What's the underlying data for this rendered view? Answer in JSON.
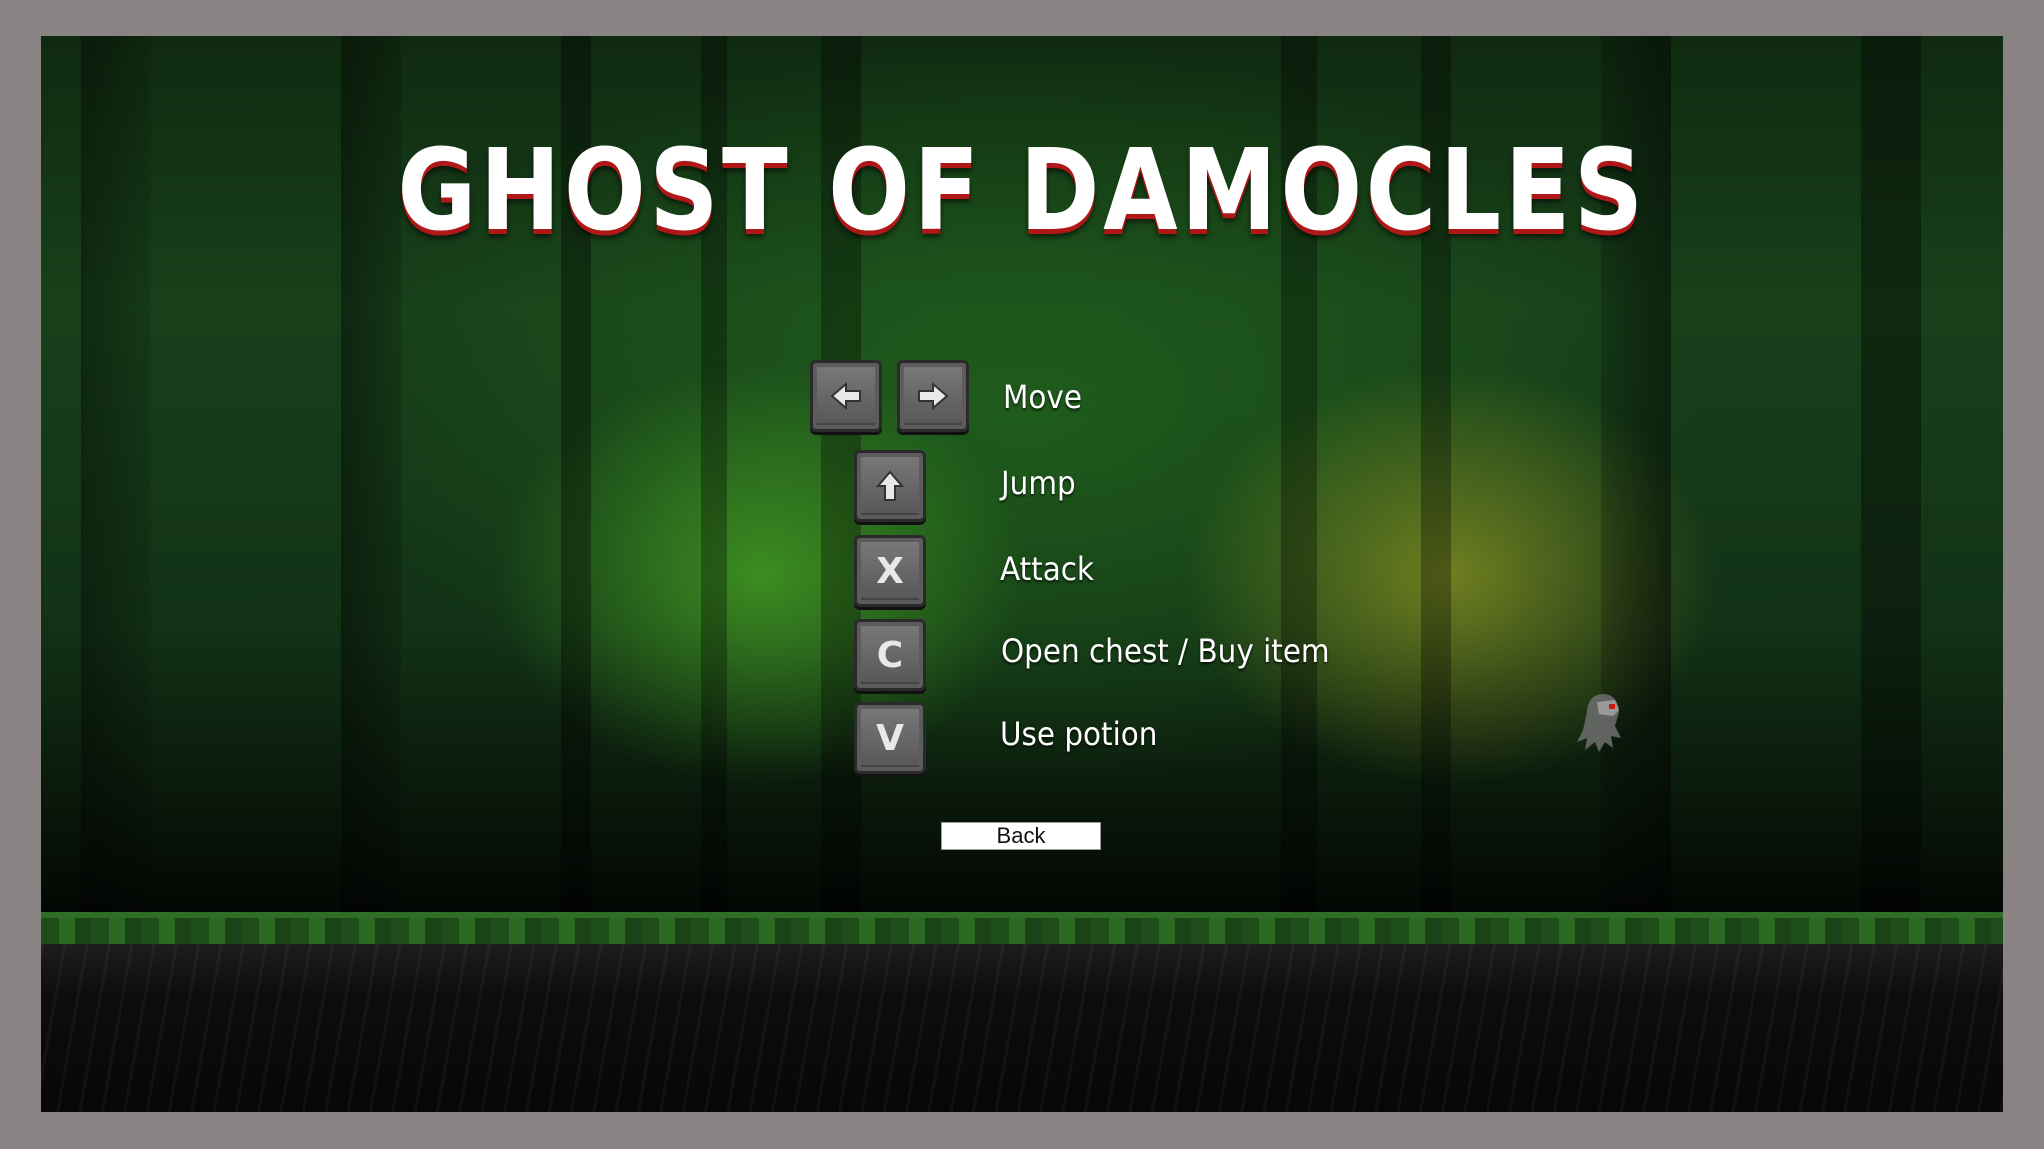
{
  "game": {
    "title": "GHOST OF DAMOCLES"
  },
  "controls": [
    {
      "keys": [
        "left-arrow-icon",
        "right-arrow-icon"
      ],
      "label": "Move"
    },
    {
      "keys": [
        "up-arrow-icon"
      ],
      "label": "Jump"
    },
    {
      "keys": [
        "X"
      ],
      "label": "Attack"
    },
    {
      "keys": [
        "C"
      ],
      "label": "Open chest / Buy item"
    },
    {
      "keys": [
        "V"
      ],
      "label": "Use potion"
    }
  ],
  "menu": {
    "back_label": "Back"
  },
  "colors": {
    "frame": "#8a8384",
    "title_text": "#ffffff",
    "title_shadow": "#b01818",
    "key_face": "#6a6a6a",
    "grass": "#2f6e27"
  }
}
